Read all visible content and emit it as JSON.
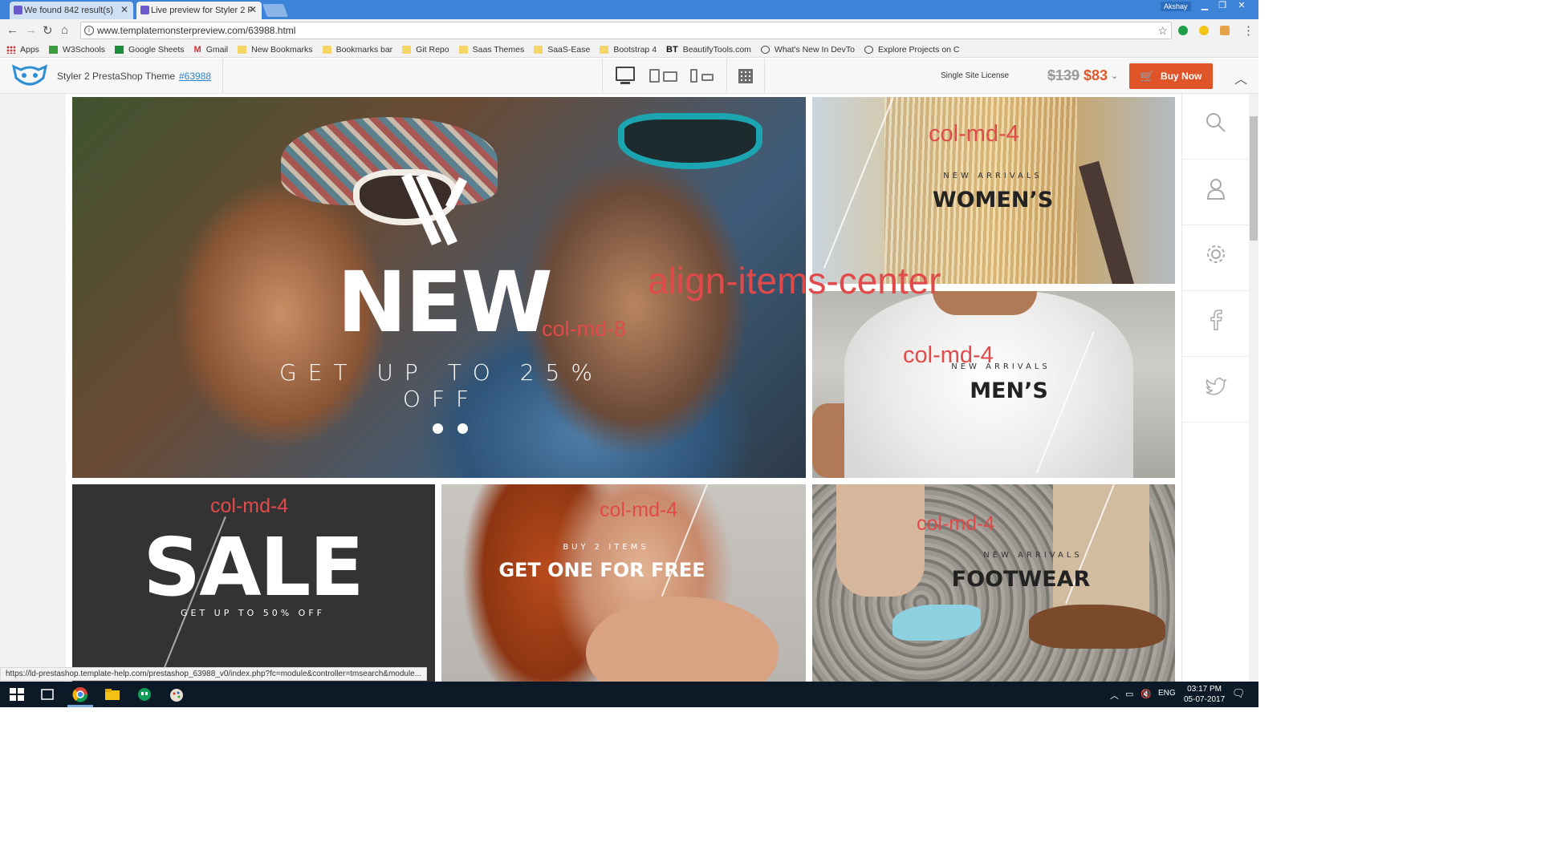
{
  "browser": {
    "tabs": [
      {
        "title": "We found 842 result(s)",
        "active": false
      },
      {
        "title": "Live preview for Styler 2 F",
        "active": true
      }
    ],
    "profile": "Akshay",
    "url": "www.templatemonsterpreview.com/63988.html",
    "bookmarks": [
      {
        "label": "Apps",
        "icon": "apps-grid-icon"
      },
      {
        "label": "W3Schools",
        "icon": "w3schools-icon"
      },
      {
        "label": "Google Sheets",
        "icon": "sheets-icon"
      },
      {
        "label": "Gmail",
        "icon": "gmail-icon"
      },
      {
        "label": "New Bookmarks",
        "icon": "folder-icon"
      },
      {
        "label": "Bookmarks bar",
        "icon": "folder-icon"
      },
      {
        "label": "Git Repo",
        "icon": "folder-icon"
      },
      {
        "label": "Saas Themes",
        "icon": "folder-icon"
      },
      {
        "label": "SaaS-Ease",
        "icon": "folder-icon"
      },
      {
        "label": "Bootstrap 4",
        "icon": "folder-icon"
      },
      {
        "label": "BeautifyTools.com",
        "icon": "bt-icon"
      },
      {
        "label": "What's New In DevTo",
        "icon": "devtools-icon"
      },
      {
        "label": "Explore Projects on C",
        "icon": "codepen-icon"
      }
    ],
    "status_url": "https://ld-prestashop.template-help.com/prestashop_63988_v0/index.php?fc=module&controller=tmsearch&module..."
  },
  "preview_header": {
    "title": "Styler 2 PrestaShop Theme",
    "id_link": "#63988",
    "license": "Single Site License",
    "old_price": "$139",
    "new_price": "$83",
    "buy_label": "Buy Now",
    "accent": "#e0542a"
  },
  "banners": {
    "hero": {
      "headline": "NEW",
      "subline": "GET UP TO 25% OFF"
    },
    "womens": {
      "small": "NEW ARRIVALS",
      "title": "WOMEN’S"
    },
    "mens": {
      "small": "NEW ARRIVALS",
      "title": "MEN’S"
    },
    "sale": {
      "headline": "SALE",
      "subline": "GET UP TO 50% OFF"
    },
    "buy2": {
      "small": "BUY 2 ITEMS",
      "title": "GET ONE FOR FREE"
    },
    "footwear": {
      "small": "NEW ARRIVALS",
      "title": "FOOTWEAR"
    }
  },
  "annotations": {
    "col8": "col-md-8",
    "col4_womens": "col-md-4",
    "col4_mens": "col-md-4",
    "col4_sale": "col-md-4",
    "col4_buy2": "col-md-4",
    "col4_foot": "col-md-4",
    "align": "align-items-center",
    "color": "#e04a4a"
  },
  "sidebar_icons": [
    "search-icon",
    "user-icon",
    "gear-icon",
    "facebook-icon",
    "twitter-icon"
  ],
  "taskbar": {
    "language": "ENG",
    "time": "03:17 PM",
    "date": "05-07-2017"
  }
}
